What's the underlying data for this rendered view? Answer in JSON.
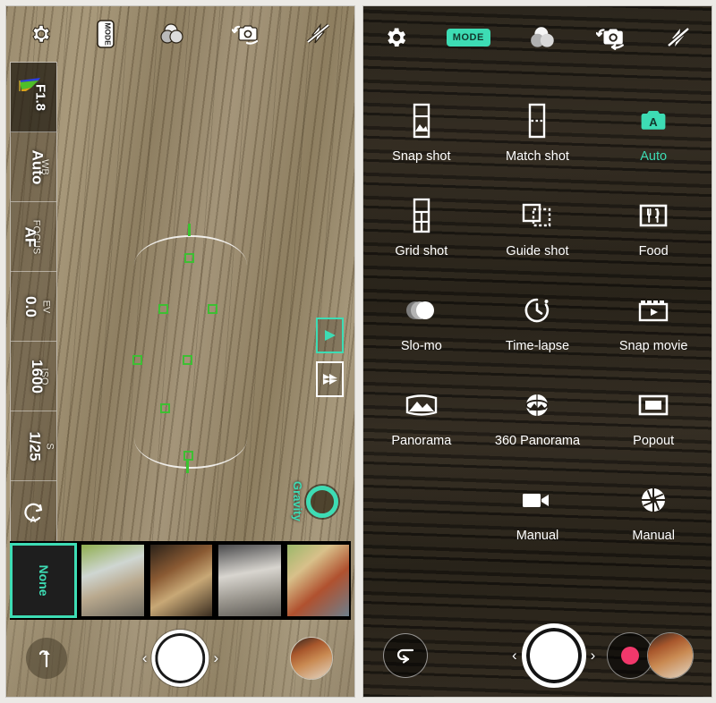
{
  "left_panel": {
    "name": "viewfinder-screen",
    "top_bar": [
      {
        "id": "settings",
        "icon": "gear-icon",
        "label": "Settings"
      },
      {
        "id": "mode",
        "icon": "mode-icon",
        "label": "MODE"
      },
      {
        "id": "filters",
        "icon": "color-filters-icon",
        "label": "Filters"
      },
      {
        "id": "switch-camera",
        "icon": "switch-camera-icon",
        "label": "Switch camera"
      },
      {
        "id": "flash",
        "icon": "flash-off-icon",
        "label": "Flash off"
      }
    ],
    "rail": [
      {
        "key": "",
        "value": "F1.8",
        "icon": "histogram-icon",
        "dark": true
      },
      {
        "key": "WB",
        "value": "Auto",
        "dark": false
      },
      {
        "key": "FOCUS",
        "value": "AF",
        "dark": false
      },
      {
        "key": "EV",
        "value": "0.0",
        "dark": false
      },
      {
        "key": "ISO",
        "value": "1600",
        "dark": false
      },
      {
        "key": "S",
        "value": "1/25",
        "dark": false
      },
      {
        "key": "",
        "value": "",
        "icon": "auto-reset-icon",
        "dark": false
      }
    ],
    "side_toggles": [
      {
        "id": "single-play",
        "icon": "play-triangle-icon",
        "active": true
      },
      {
        "id": "multi-play",
        "icon": "multi-arrow-icon",
        "active": false
      }
    ],
    "gravity": {
      "label": "Gravity",
      "icon": "level-ring-icon"
    },
    "filmstrip": {
      "items": [
        {
          "label": "None",
          "selected": true,
          "thumb": ""
        },
        {
          "label": "",
          "selected": false,
          "thumb": "ph1"
        },
        {
          "label": "",
          "selected": false,
          "thumb": "ph2"
        },
        {
          "label": "",
          "selected": false,
          "thumb": "ph3"
        },
        {
          "label": "",
          "selected": false,
          "thumb": "ph4"
        }
      ]
    },
    "bottom_bar": {
      "left_icon": "upload-arrow-icon",
      "shutter": "shutter-button",
      "chev_left": "‹",
      "chev_right": "›",
      "thumbnail": "gallery-thumbnail"
    }
  },
  "right_panel": {
    "name": "mode-menu-screen",
    "top_bar": [
      {
        "id": "settings",
        "icon": "gear-icon",
        "label": "Settings"
      },
      {
        "id": "mode",
        "icon": "mode-chip",
        "label": "MODE",
        "active": true
      },
      {
        "id": "filters",
        "icon": "color-filters-icon",
        "label": "Filters"
      },
      {
        "id": "switch-camera",
        "icon": "switch-camera-icon",
        "label": "Switch camera"
      },
      {
        "id": "flash",
        "icon": "flash-off-icon",
        "label": "Flash off"
      }
    ],
    "modes": [
      {
        "label": "Snap shot",
        "icon": "snap-shot-icon",
        "active": false
      },
      {
        "label": "Match shot",
        "icon": "match-shot-icon",
        "active": false
      },
      {
        "label": "Auto",
        "icon": "auto-camera-icon",
        "active": true
      },
      {
        "label": "Grid shot",
        "icon": "grid-shot-icon",
        "active": false
      },
      {
        "label": "Guide shot",
        "icon": "guide-shot-icon",
        "active": false
      },
      {
        "label": "Food",
        "icon": "food-icon",
        "active": false
      },
      {
        "label": "Slo-mo",
        "icon": "slomo-icon",
        "active": false
      },
      {
        "label": "Time-lapse",
        "icon": "timelapse-icon",
        "active": false
      },
      {
        "label": "Snap movie",
        "icon": "snap-movie-icon",
        "active": false
      },
      {
        "label": "Panorama",
        "icon": "panorama-icon",
        "active": false
      },
      {
        "label": "360 Panorama",
        "icon": "panorama360-icon",
        "active": false
      },
      {
        "label": "Popout",
        "icon": "popout-icon",
        "active": false
      },
      {
        "label": "",
        "icon": "",
        "active": false
      },
      {
        "label": "Manual",
        "icon": "video-camera-icon",
        "active": false
      },
      {
        "label": "Manual",
        "icon": "aperture-icon",
        "active": false
      }
    ],
    "bottom_bar": {
      "back_icon": "back-arrow-icon",
      "shutter": "shutter-button",
      "record_icon": "record-dot-icon",
      "chev_left": "‹",
      "chev_right": "›",
      "thumbnail": "gallery-thumbnail"
    }
  },
  "colors": {
    "accent_teal": "#3ddcb4",
    "record_pink": "#f2386b",
    "af_green": "#3dbf33",
    "white": "#ffffff"
  }
}
